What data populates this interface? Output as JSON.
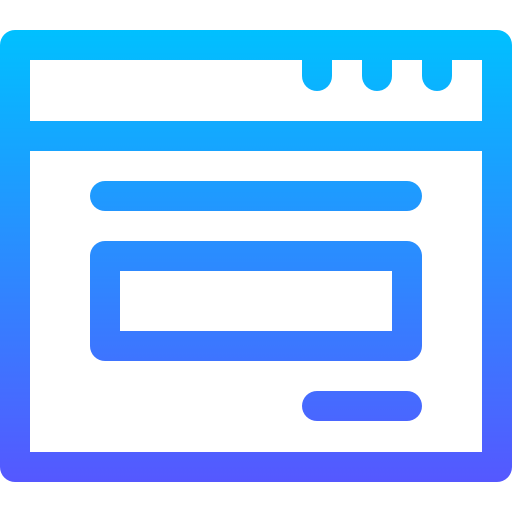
{
  "icon": {
    "name": "browser-window-form-icon",
    "style": "outline-gradient",
    "gradient": {
      "direction": "top-to-bottom",
      "stops": [
        "#00c0ff",
        "#5558ff"
      ]
    },
    "background": "#ffffff",
    "window_control_count": 3,
    "parts": [
      "window-frame",
      "title-bar",
      "window-controls",
      "heading-line",
      "input-field",
      "action-button"
    ]
  }
}
